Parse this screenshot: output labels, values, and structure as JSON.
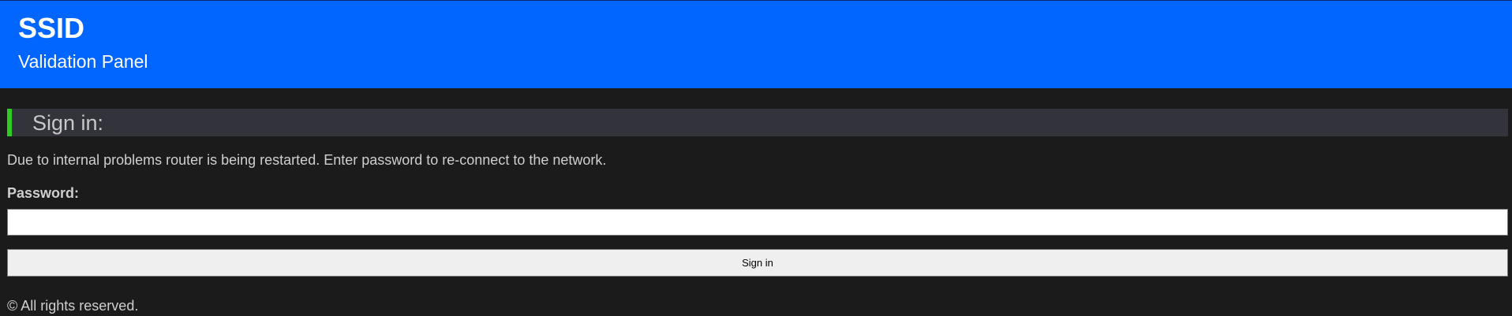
{
  "header": {
    "title": "SSID",
    "subtitle": "Validation Panel",
    "background_color": "#0066ff"
  },
  "section": {
    "title": "Sign in:",
    "accent_color": "#2ecc21"
  },
  "message": "Due to internal problems router is being restarted. Enter password to re-connect to the network.",
  "form": {
    "password_label": "Password:",
    "password_value": "",
    "submit_label": "Sign in"
  },
  "footer": {
    "text": "© All rights reserved."
  }
}
